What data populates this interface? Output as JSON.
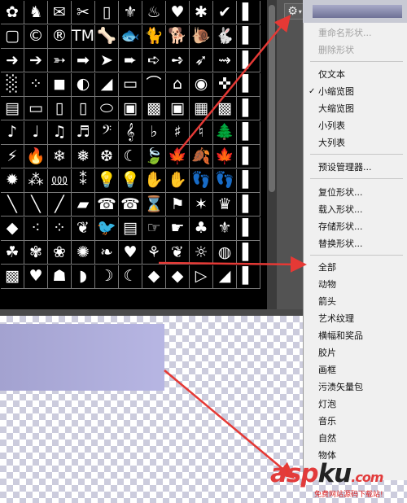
{
  "shape_rows": [
    [
      "✿",
      "♞",
      "✉",
      "✂",
      "▯",
      "⚜",
      "♨",
      "♥",
      "✱",
      "✔",
      "▌"
    ],
    [
      "▢",
      "©",
      "®",
      "TM",
      "🦴",
      "🐟",
      "🐈",
      "🐕",
      "🐌",
      "🐇",
      "▌"
    ],
    [
      "➜",
      "➔",
      "➳",
      "➡",
      "➤",
      "➨",
      "➪",
      "➺",
      "➶",
      "⇝",
      "▌"
    ],
    [
      "░",
      "⁘",
      "◼",
      "◐",
      "◢",
      "▭",
      "⌒",
      "⌂",
      "◉",
      "✜",
      "▌"
    ],
    [
      "▤",
      "▭",
      "▯",
      "▯",
      "⬭",
      "▣",
      "▩",
      "▣",
      "▦",
      "▩",
      "▌"
    ],
    [
      "♪",
      "♩",
      "♫",
      "♬",
      "𝄢",
      "𝄞",
      "♭",
      "♯",
      "♮",
      "🌲",
      "▌"
    ],
    [
      "⚡",
      "🔥",
      "❄",
      "❅",
      "❆",
      "☾",
      "🍃",
      "🍁",
      "🍂",
      "🍁",
      "▌"
    ],
    [
      "✹",
      "⁂",
      "⅏",
      "⁑",
      "💡",
      "💡",
      "✋",
      "✋",
      "👣",
      "👣",
      "▌"
    ],
    [
      "╲",
      "╲",
      "╱",
      "▰",
      "☎",
      "☎",
      "⌛",
      "⚑",
      "✶",
      "♛",
      "▌"
    ],
    [
      "◆",
      "⁖",
      "⁘",
      "❦",
      "🐦",
      "▤",
      "☞",
      "☛",
      "♣",
      "⚜",
      "▌"
    ],
    [
      "☘",
      "✾",
      "❀",
      "✺",
      "❧",
      "♥",
      "⚘",
      "❦",
      "☼",
      "◍",
      "▌"
    ],
    [
      "▩",
      "♥",
      "☗",
      "◗",
      "☽",
      "☾",
      "◆",
      "◆",
      "▷",
      "◢",
      "▌"
    ]
  ],
  "gear_button": {
    "icon": "⚙",
    "caret": "▾"
  },
  "menu": {
    "rename": "重命名形状...",
    "delete": "删除形状",
    "text_only": "仅文本",
    "small_thumb": "小缩览图",
    "large_thumb": "大缩览图",
    "small_list": "小列表",
    "large_list": "大列表",
    "preset_manager": "预设管理器...",
    "reset": "复位形状...",
    "load": "载入形状...",
    "save": "存储形状...",
    "replace": "替换形状...",
    "categories": [
      "全部",
      "动物",
      "箭头",
      "艺术纹理",
      "横幅和奖品",
      "胶片",
      "画框",
      "污渍矢量包",
      "灯泡",
      "音乐",
      "自然",
      "物体"
    ],
    "checkmark": "✓"
  },
  "watermark": {
    "asp": "asp",
    "ku": "ku",
    ".com": ".com",
    "tagline": "免费网站源码下载站!"
  },
  "colors": {
    "arrow": "#e53935",
    "panel": "#535353",
    "menu_bg": "#f0f0f0"
  }
}
